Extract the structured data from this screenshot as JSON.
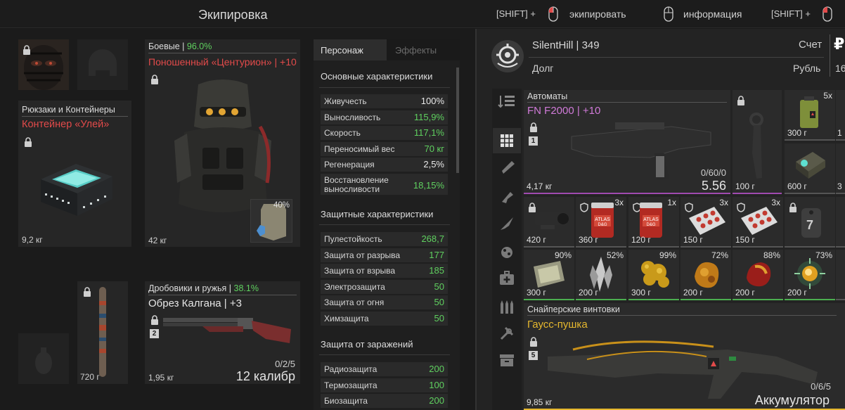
{
  "header": {
    "title": "Экипировка",
    "equip_hint_prefix": "[SHIFT] +",
    "equip_hint": "экипировать",
    "info_hint": "информация",
    "third_hint_prefix": "[SHIFT] +"
  },
  "backpack": {
    "category": "Рюкзаки и Контейнеры",
    "name": "Контейнер «Улей»",
    "weight": "9,2 кг"
  },
  "armor": {
    "category": "Боевые",
    "sep": " | ",
    "percent": "96.0%",
    "name": "Поношенный «Центурион» | +10",
    "weight": "42 кг",
    "plate_percent": "40%"
  },
  "melee": {
    "weight": "720 г"
  },
  "shotgun": {
    "category": "Дробовики и ружья",
    "sep": " | ",
    "percent": "38.1%",
    "name": "Обрез Калгана | +3",
    "slot": "2",
    "ammo": "0/2/5",
    "weight": "1,95 кг",
    "caliber": "12 калибр"
  },
  "stats": {
    "tab_character": "Персонаж",
    "tab_effects": "Эффекты",
    "main_title": "Основные характеристики",
    "main": [
      {
        "label": "Живучесть",
        "value": "100%",
        "color": "#e8e8e8"
      },
      {
        "label": "Выносливость",
        "value": "115,9%",
        "color": "#5fd05f"
      },
      {
        "label": "Скорость",
        "value": "117,1%",
        "color": "#5fd05f"
      },
      {
        "label": "Переносимый вес",
        "value": "70 кг",
        "color": "#5fd05f"
      },
      {
        "label": "Регенерация",
        "value": "2,5%",
        "color": "#e8e8e8"
      },
      {
        "label": "Восстановление выносливости",
        "value": "18,15%",
        "color": "#5fd05f"
      }
    ],
    "protect_title": "Защитные характеристики",
    "protect": [
      {
        "label": "Пулестойкость",
        "value": "268,7",
        "color": "#5fd05f"
      },
      {
        "label": "Защита от разрыва",
        "value": "177",
        "color": "#5fd05f"
      },
      {
        "label": "Защита от взрыва",
        "value": "185",
        "color": "#5fd05f"
      },
      {
        "label": "Электрозащита",
        "value": "50",
        "color": "#5fd05f"
      },
      {
        "label": "Защита от огня",
        "value": "50",
        "color": "#5fd05f"
      },
      {
        "label": "Химзащита",
        "value": "50",
        "color": "#5fd05f"
      }
    ],
    "infect_title": "Защита от заражений",
    "infect": [
      {
        "label": "Радиозащита",
        "value": "200",
        "color": "#5fd05f"
      },
      {
        "label": "Термозащита",
        "value": "100",
        "color": "#5fd05f"
      },
      {
        "label": "Биозащита",
        "value": "200",
        "color": "#5fd05f"
      }
    ]
  },
  "profile": {
    "name": "SilentHill",
    "sep": " | ",
    "level": "349",
    "debt": "Долг",
    "account": "Счет",
    "currency": "Рубль",
    "currency_symbol": "₽",
    "amount_partial": "16"
  },
  "inventory": {
    "rifle": {
      "category": "Автоматы",
      "name": "FN F2000 | +10",
      "slot": "1",
      "ammo": "0/60/0",
      "value": "5.56",
      "weight": "4,17 кг"
    },
    "knife": {
      "weight": "100 г"
    },
    "item_a": {
      "count": "5x",
      "weight": "300 г"
    },
    "item_b": {
      "weight": "600 г"
    },
    "scope": {
      "weight": "420 г"
    },
    "can1": {
      "count": "3x",
      "weight": "360 г"
    },
    "can2": {
      "count": "1x",
      "weight": "120 г"
    },
    "pills1": {
      "count": "3x",
      "weight": "150 г"
    },
    "pills2": {
      "count": "3x",
      "weight": "150 г"
    },
    "tag": {
      "label": "7"
    },
    "art1": {
      "percent": "90%",
      "weight": "300 г"
    },
    "art2": {
      "percent": "52%",
      "weight": "200 г"
    },
    "art3": {
      "percent": "99%",
      "weight": "300 г"
    },
    "art4": {
      "percent": "72%",
      "weight": "200 г"
    },
    "art5": {
      "percent": "88%",
      "weight": "200 г"
    },
    "art6": {
      "percent": "73%",
      "weight": "200 г"
    },
    "sniper": {
      "category": "Снайперские винтовки",
      "name": "Гаусс-пушка",
      "slot": "5",
      "ammo": "0/6/5",
      "ammo_type": "Аккумулятор",
      "weight": "9,85 кг"
    },
    "partial_1": "1",
    "partial_3": "3"
  },
  "colors": {
    "accent_green": "#5fd05f",
    "accent_red": "#e24a4a",
    "accent_pink": "#d07ad8",
    "accent_gold": "#e6b82e"
  }
}
